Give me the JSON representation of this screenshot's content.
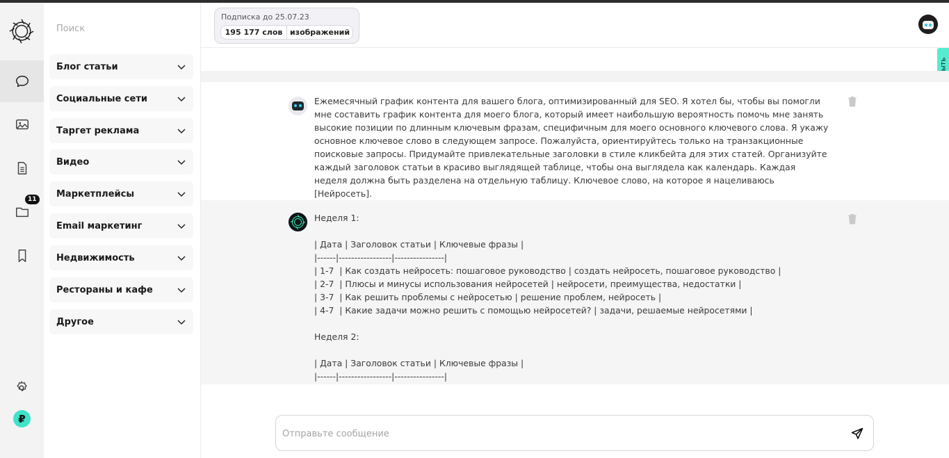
{
  "search": {
    "placeholder": "Поиск"
  },
  "nav": {
    "badge_count": "11"
  },
  "categories": [
    {
      "label": "Блог статьи"
    },
    {
      "label": "Социальные сети"
    },
    {
      "label": "Таргет реклама"
    },
    {
      "label": "Видео"
    },
    {
      "label": "Маркетплейсы"
    },
    {
      "label": "Email маркетинг"
    },
    {
      "label": "Недвижимость"
    },
    {
      "label": "Рестораны и кафе"
    },
    {
      "label": "Другое"
    }
  ],
  "subscription": {
    "title": "Подписка до 25.07.23",
    "words": "195 177 слов",
    "images": "изображений"
  },
  "side_tab": {
    "label": "Открыть"
  },
  "messages": [
    {
      "role": "user",
      "text": "Ежемесячный график контента для вашего блога, оптимизированный для SEO. Я хотел бы, чтобы вы помогли мне составить график контента для моего блога, который имеет наибольшую вероятность помочь мне занять высокие позиции по длинным ключевым фразам, специфичным для моего основного ключевого слова. Я укажу основное ключевое слово в следующем запросе. Пожалуйста, ориентируйтесь только на транзакционные поисковые запросы. Придумайте привлекательные заголовки в стиле кликбейта для этих статей. Организуйте каждый заголовок статьи в красиво выглядящей таблице, чтобы она выглядела как календарь. Каждая неделя должна быть разделена на отдельную таблицу. Ключевое слово, на которое я нацеливаюсь [Нейросеть]."
    },
    {
      "role": "assistant",
      "text": "Неделя 1:\n\n| Дата | Заголовок статьи | Ключевые фразы |\n|------|-----------------|----------------|\n| 1-7  | Как создать нейросеть: пошаговое руководство | создать нейросеть, пошаговое руководство |\n| 2-7  | Плюсы и минусы использования нейросетей | нейросети, преимущества, недостатки |\n| 3-7  | Как решить проблемы с нейросетью | решение проблем, нейросеть |\n| 4-7  | Какие задачи можно решить с помощью нейросетей? | задачи, решаемые нейросетями |\n\nНеделя 2:\n\n| Дата | Заголовок статьи | Ключевые фразы |\n|------|-----------------|----------------|"
    }
  ],
  "composer": {
    "placeholder": "Отправьте сообщение"
  },
  "colors": {
    "accent": "#3ee3c9",
    "side_tab": "#55ecd0"
  }
}
